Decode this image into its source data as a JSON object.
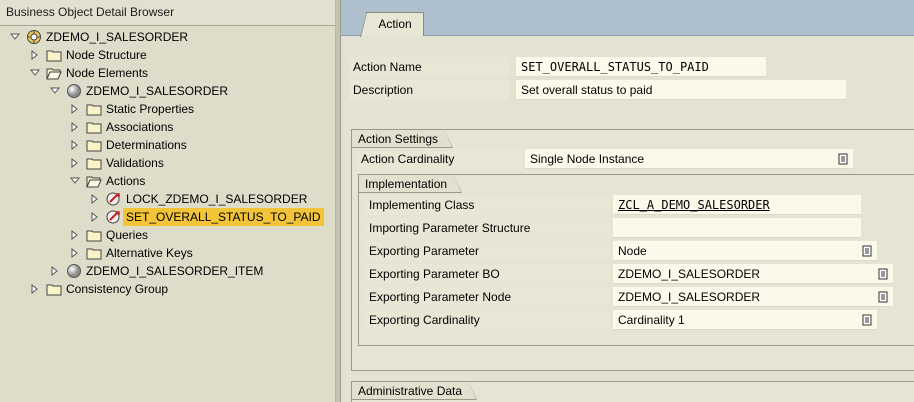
{
  "tree": {
    "title": "Business Object Detail Browser",
    "nodes": [
      {
        "label": "ZDEMO_I_SALESORDER",
        "icon": "business-object-icon",
        "expanded": true
      },
      {
        "label": "Node Structure",
        "icon": "folder-icon",
        "expanded": false
      },
      {
        "label": "Node Elements",
        "icon": "folder-open-icon",
        "expanded": true
      },
      {
        "label": "ZDEMO_I_SALESORDER",
        "icon": "node-element-icon",
        "expanded": true
      },
      {
        "label": "Static Properties",
        "icon": "folder-icon",
        "expanded": false
      },
      {
        "label": "Associations",
        "icon": "folder-icon",
        "expanded": false
      },
      {
        "label": "Determinations",
        "icon": "folder-icon",
        "expanded": false
      },
      {
        "label": "Validations",
        "icon": "folder-icon",
        "expanded": false
      },
      {
        "label": "Actions",
        "icon": "folder-open-icon",
        "expanded": true
      },
      {
        "label": "LOCK_ZDEMO_I_SALESORDER",
        "icon": "action-icon",
        "expanded": false
      },
      {
        "label": "SET_OVERALL_STATUS_TO_PAID",
        "icon": "action-icon",
        "expanded": false,
        "selected": true
      },
      {
        "label": "Queries",
        "icon": "folder-icon",
        "expanded": false
      },
      {
        "label": "Alternative Keys",
        "icon": "folder-icon",
        "expanded": false
      },
      {
        "label": "ZDEMO_I_SALESORDER_ITEM",
        "icon": "node-element-icon",
        "expanded": false
      },
      {
        "label": "Consistency Group",
        "icon": "folder-icon",
        "expanded": false
      }
    ]
  },
  "detail": {
    "tab_label": "Action",
    "action_name_label": "Action Name",
    "action_name_value": "SET_OVERALL_STATUS_TO_PAID",
    "description_label": "Description",
    "description_value": "Set overall status to paid",
    "action_settings": {
      "title": "Action Settings",
      "cardinality_label": "Action Cardinality",
      "cardinality_value": "Single Node Instance"
    },
    "implementation": {
      "title": "Implementation",
      "implementing_class_label": "Implementing Class",
      "implementing_class_value": "ZCL_A_DEMO_SALESORDER",
      "importing_param_label": "Importing Parameter Structure",
      "importing_param_value": "",
      "exporting_param_label": "Exporting Parameter",
      "exporting_param_value": "Node",
      "exporting_bo_label": "Exporting Parameter BO",
      "exporting_bo_value": "ZDEMO_I_SALESORDER",
      "exporting_node_label": "Exporting Parameter Node",
      "exporting_node_value": "ZDEMO_I_SALESORDER",
      "exporting_cardinality_label": "Exporting Cardinality",
      "exporting_cardinality_value": "Cardinality 1"
    },
    "admin_title": "Administrative Data"
  },
  "colors": {
    "selection": "#f2c43a",
    "tab_strip": "#aebfce",
    "panel_bg": "#deddc9",
    "field_bg": "#fbfaea"
  }
}
